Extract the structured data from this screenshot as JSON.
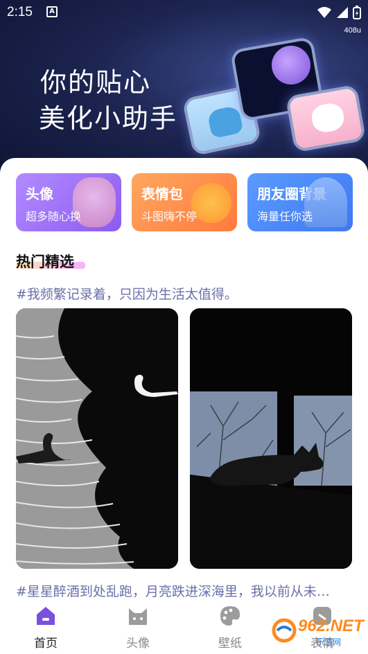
{
  "status_bar": {
    "time": "2:15",
    "notification_icon": "A",
    "net_speed": "408u"
  },
  "hero": {
    "title_line1": "你的贴心",
    "title_line2": "美化小助手"
  },
  "categories": [
    {
      "title": "头像",
      "subtitle": "超多随心换",
      "color": "#9b6cf5"
    },
    {
      "title": "表情包",
      "subtitle": "斗图嗨不停",
      "color": "#ff8c47"
    },
    {
      "title": "朋友圈背景",
      "subtitle": "海量任你选",
      "color": "#4c8bf8"
    }
  ],
  "section": {
    "title": "热门精选"
  },
  "posts": [
    {
      "caption": "#我频繁记录着，只因为生活太值得。"
    },
    {
      "caption": "#星星醉酒到处乱跑，月亮跌进深海里，我以前从未…"
    }
  ],
  "bottom_nav": [
    {
      "label": "首页",
      "icon": "home-icon",
      "active": true
    },
    {
      "label": "头像",
      "icon": "cat-face-icon",
      "active": false
    },
    {
      "label": "壁纸",
      "icon": "palette-icon",
      "active": false
    },
    {
      "label": "表情",
      "icon": "sticker-icon",
      "active": false
    }
  ],
  "watermark": {
    "text": "962.NET",
    "sub": "乐游网"
  },
  "colors": {
    "accent": "#7b4fe0",
    "caption": "#6a6fa8"
  }
}
